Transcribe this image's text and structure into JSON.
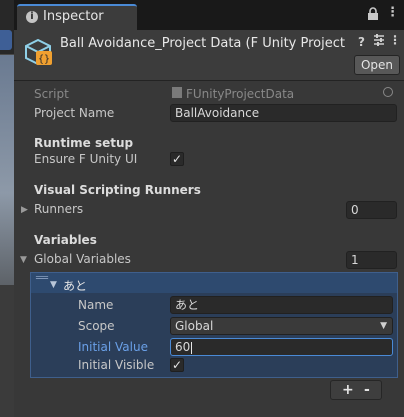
{
  "tab": {
    "title": "Inspector"
  },
  "header": {
    "object_title": "Ball Avoidance_Project Data (F Unity Project Data",
    "open_label": "Open"
  },
  "fields": {
    "script_label": "Script",
    "script_value": "FUnityProjectData",
    "project_name_label": "Project Name",
    "project_name_value": "BallAvoidance"
  },
  "runtime": {
    "heading": "Runtime setup",
    "ensure_label": "Ensure F Unity UI",
    "ensure_checked": true
  },
  "runners": {
    "heading": "Visual Scripting Runners",
    "label": "Runners",
    "count": "0"
  },
  "variables": {
    "heading": "Variables",
    "global_label": "Global Variables",
    "global_count": "1",
    "item_title": "あと",
    "name_label": "Name",
    "name_value": "あと",
    "scope_label": "Scope",
    "scope_value": "Global",
    "initial_value_label": "Initial Value",
    "initial_value": "60",
    "initial_visible_label": "Initial Visible",
    "initial_visible_checked": true
  },
  "list_buttons": {
    "add": "+",
    "remove": "-"
  },
  "colors": {
    "accent": "#4a8ad6",
    "highlight_label": "#6aa0e8",
    "selected_panel": "#2b3e59"
  }
}
